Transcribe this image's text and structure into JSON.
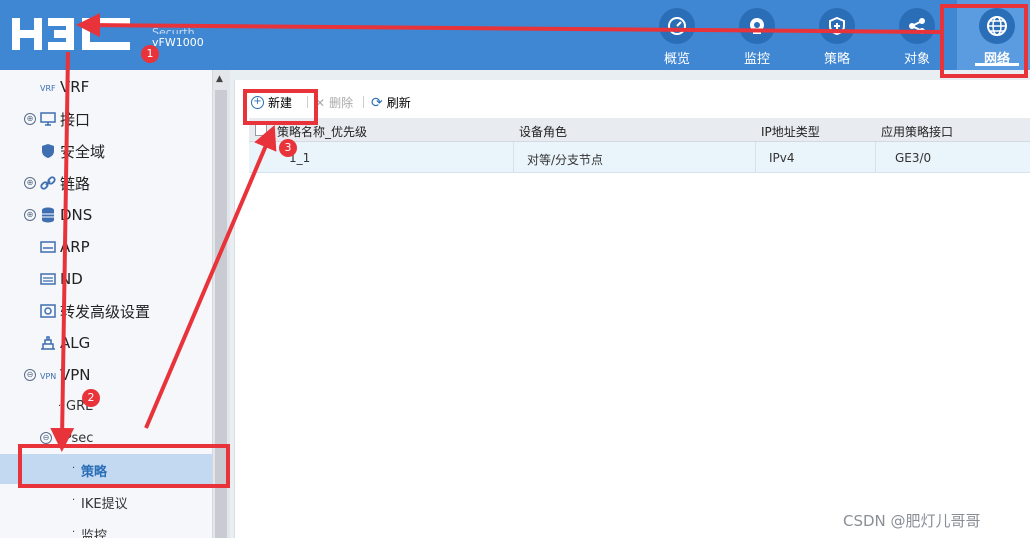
{
  "header": {
    "brand": "H3C",
    "product_line1": "Securth",
    "product_line2": "vFW1000",
    "nav": [
      {
        "label": "概览",
        "icon": "gauge-icon"
      },
      {
        "label": "监控",
        "icon": "camera-icon"
      },
      {
        "label": "策略",
        "icon": "shield-icon"
      },
      {
        "label": "对象",
        "icon": "share-icon"
      },
      {
        "label": "网络",
        "icon": "globe-icon",
        "active": true
      }
    ]
  },
  "sidebar": {
    "items": [
      {
        "label": "VRF",
        "icon": "vrf-icon"
      },
      {
        "label": "接口",
        "icon": "monitor-icon",
        "expand": "⊕"
      },
      {
        "label": "安全域",
        "icon": "shield-icon"
      },
      {
        "label": "链路",
        "icon": "link-icon",
        "expand": "⊕"
      },
      {
        "label": "DNS",
        "icon": "database-icon",
        "expand": "⊕"
      },
      {
        "label": "ARP",
        "icon": "arp-icon"
      },
      {
        "label": "ND",
        "icon": "nd-icon"
      },
      {
        "label": "转发高级设置",
        "icon": "settings-icon"
      },
      {
        "label": "ALG",
        "icon": "alg-icon"
      },
      {
        "label": "VPN",
        "icon": "vpn-icon",
        "expand": "⊖"
      }
    ],
    "sub_items": [
      {
        "label": "GRE"
      },
      {
        "label": "IPsec"
      },
      {
        "label": "策略",
        "selected": true
      },
      {
        "label": "IKE提议"
      },
      {
        "label": "监控"
      }
    ]
  },
  "toolbar": {
    "new_label": "新建",
    "delete_label": "删除",
    "refresh_label": "刷新"
  },
  "table": {
    "columns": [
      "策略名称_优先级",
      "设备角色",
      "IP地址类型",
      "应用策略接口"
    ],
    "rows": [
      [
        "1_1",
        "对等/分支节点",
        "IPv4",
        "GE3/0"
      ]
    ]
  },
  "annotations": {
    "badges": [
      "1",
      "2",
      "3"
    ]
  },
  "watermark": "CSDN @肥灯儿哥哥",
  "colors": {
    "header_bg": "#3f86d3",
    "accent": "#2a6eb8",
    "annotation_red": "#e8333a",
    "selected_bg": "#c3d9f1"
  }
}
